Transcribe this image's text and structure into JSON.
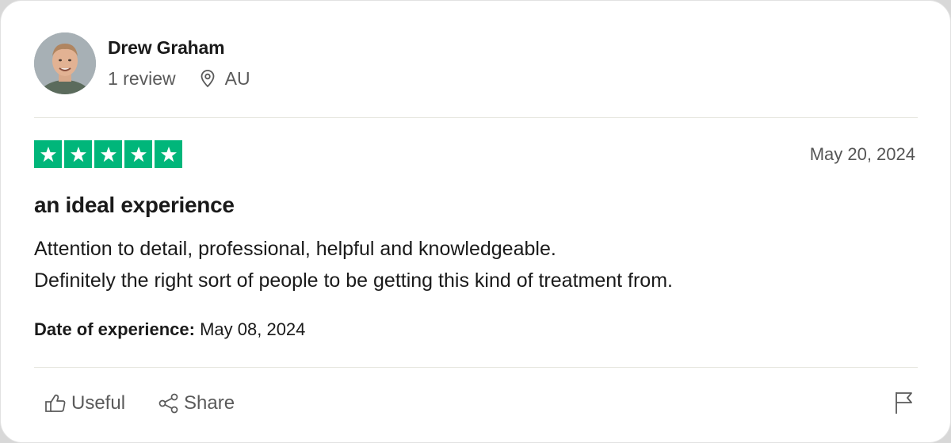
{
  "reviewer": {
    "name": "Drew Graham",
    "review_count": "1 review",
    "location": "AU",
    "avatar_icon": "reviewer-avatar-photo"
  },
  "review": {
    "rating": 5,
    "max_rating": 5,
    "star_color": "#00b67a",
    "date": "May 20, 2024",
    "title": "an ideal experience",
    "body_lines": [
      "Attention to detail, professional, helpful and knowledgeable.",
      "Definitely the right sort of people to be getting this kind of treatment from."
    ],
    "experience_label": "Date of experience:",
    "experience_date": "May 08, 2024"
  },
  "actions": {
    "useful_label": "Useful",
    "useful_icon": "thumbs-up-icon",
    "share_label": "Share",
    "share_icon": "share-icon",
    "flag_icon": "flag-icon"
  }
}
